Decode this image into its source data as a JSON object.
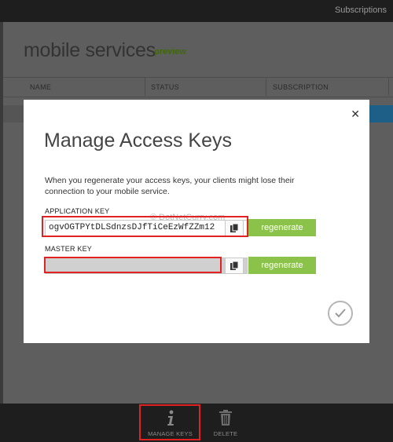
{
  "topbar": {
    "subscriptions_label": "Subscriptions"
  },
  "page": {
    "title": "mobile services",
    "preview_badge": "preview",
    "columns": [
      "NAME",
      "STATUS",
      "SUBSCRIPTION"
    ]
  },
  "dialog": {
    "title": "Manage Access Keys",
    "description": "When you regenerate your access keys, your clients might lose their connection to your mobile service.",
    "application_key": {
      "label": "APPLICATION KEY",
      "value": "ogvOGTPYtDLSdnzsDJfTiCeEzWfZZm12",
      "regenerate_label": "regenerate"
    },
    "master_key": {
      "label": "MASTER KEY",
      "value": "",
      "regenerate_label": "regenerate"
    },
    "watermark": "© DotNetCurry.com"
  },
  "commands": [
    {
      "label": "MANAGE KEYS",
      "icon": "info-icon"
    },
    {
      "label": "DELETE",
      "icon": "trash-icon"
    }
  ],
  "colors": {
    "accent_green": "#8bc34a",
    "highlight_red": "#e02222",
    "selection_blue": "#1d5f86"
  }
}
